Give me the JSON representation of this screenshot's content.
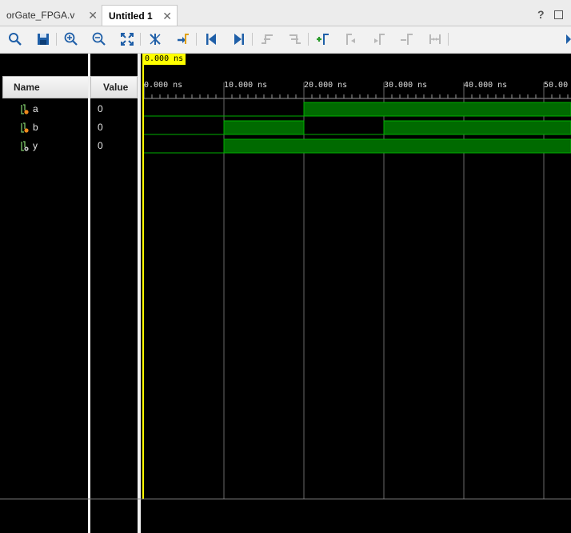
{
  "tabs": [
    {
      "label": "orGate_FPGA.v",
      "active": false
    },
    {
      "label": "Untitled 1",
      "active": true
    }
  ],
  "window_controls": {
    "help": "?"
  },
  "toolbar": {
    "icons": [
      "search-icon",
      "save-icon",
      "zoom-in-icon",
      "zoom-out-icon",
      "zoom-fit-icon",
      "marker-off-icon",
      "go-to-cursor-icon",
      "go-to-start-icon",
      "go-to-end-icon",
      "previous-transition-icon",
      "next-transition-icon",
      "add-marker-icon",
      "previous-marker-icon",
      "next-marker-icon",
      "swap-cursors-icon",
      "snap-to-transition-icon"
    ]
  },
  "columns": {
    "name": "Name",
    "value": "Value"
  },
  "cursor": {
    "label": "0.000 ns",
    "time_ns": 0
  },
  "time_axis": {
    "ticks": [
      "0.000 ns",
      "10.000 ns",
      "20.000 ns",
      "30.000 ns",
      "40.000 ns",
      "50.00"
    ],
    "tick_times_ns": [
      0,
      10,
      20,
      30,
      40,
      50
    ]
  },
  "signals": [
    {
      "name": "a",
      "value": "0",
      "transitions": [
        {
          "t": 0,
          "v": 0
        },
        {
          "t": 20,
          "v": 1
        }
      ]
    },
    {
      "name": "b",
      "value": "0",
      "transitions": [
        {
          "t": 0,
          "v": 0
        },
        {
          "t": 10,
          "v": 1
        },
        {
          "t": 20,
          "v": 0
        },
        {
          "t": 30,
          "v": 1
        }
      ]
    },
    {
      "name": "y",
      "value": "0",
      "transitions": [
        {
          "t": 0,
          "v": 0
        },
        {
          "t": 10,
          "v": 1
        }
      ]
    }
  ],
  "colors": {
    "waveform": "#00b000",
    "high_fill": "#006a00",
    "cursor": "#ffff00",
    "grid": "#6a6a6a",
    "background": "#000000"
  }
}
